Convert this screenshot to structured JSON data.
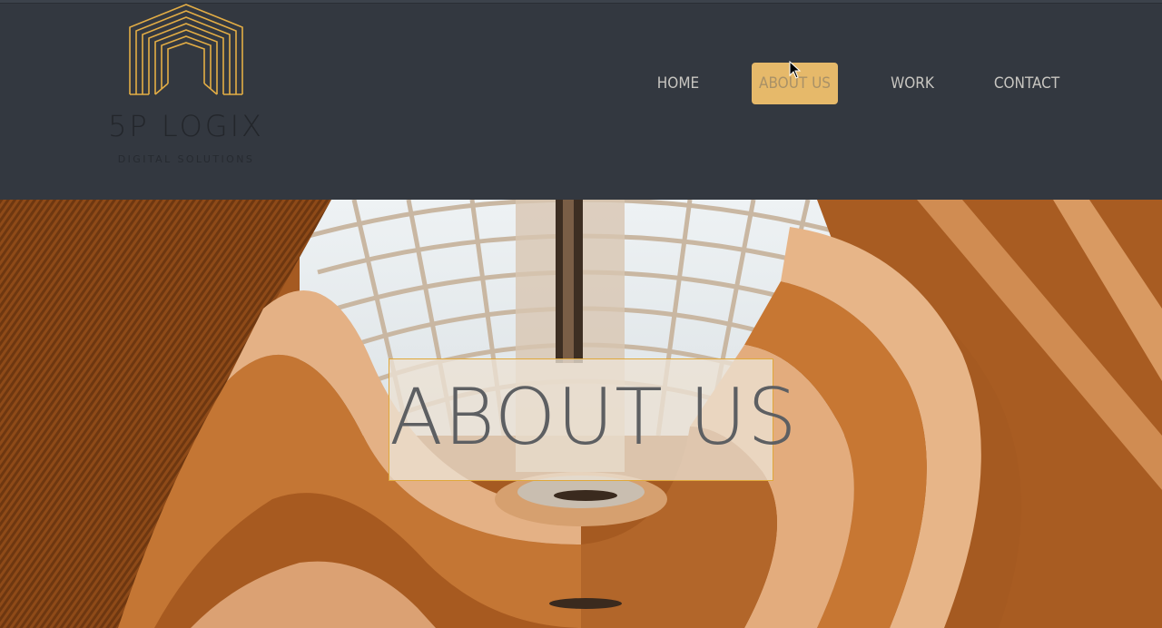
{
  "brand": {
    "name": "5P LOGIX",
    "tagline": "DIGITAL SOLUTIONS",
    "logo_icon": "house-lines-logo",
    "accent_color": "#e6b96a"
  },
  "nav": {
    "items": [
      {
        "label": "HOME",
        "active": false
      },
      {
        "label": "ABOUT US",
        "active": true
      },
      {
        "label": "WORK",
        "active": false
      },
      {
        "label": "CONTACT",
        "active": false
      }
    ]
  },
  "hero": {
    "title": "ABOUT US",
    "background": "spiral-wooden-atrium-photo"
  },
  "colors": {
    "header_bg": "#333840",
    "nav_text": "#c8c6c1",
    "active_bg": "#e6b96a",
    "title_text": "#5d5f62"
  }
}
